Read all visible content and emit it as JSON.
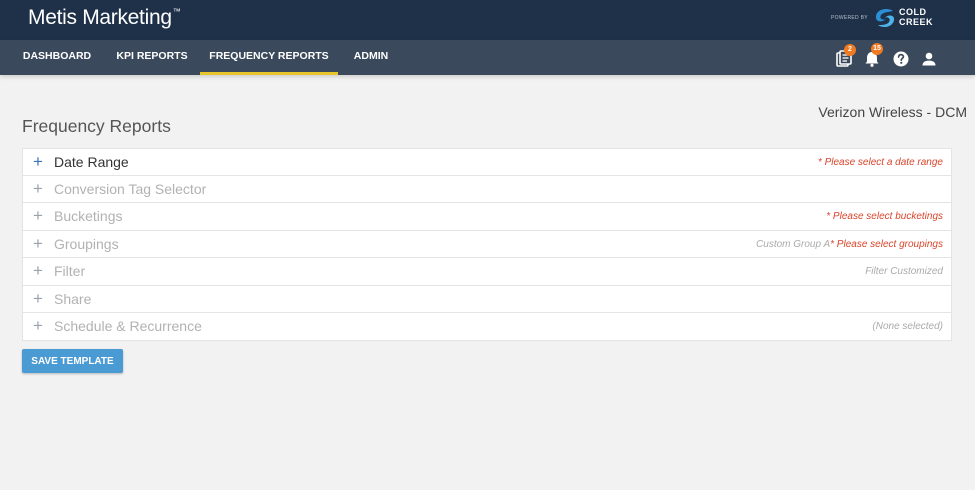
{
  "app": {
    "brand": "Metis Marketing",
    "brand_tm": "™",
    "powered_by": "POWERED BY",
    "partner_line1": "COLD",
    "partner_line2": "CREEK"
  },
  "nav": {
    "items": [
      {
        "label": "DASHBOARD"
      },
      {
        "label": "KPI REPORTS"
      },
      {
        "label": "FREQUENCY REPORTS",
        "active": true
      },
      {
        "label": "ADMIN"
      }
    ],
    "icons": [
      {
        "name": "reports-icon",
        "badge": "2"
      },
      {
        "name": "bell-icon",
        "badge": "15"
      },
      {
        "name": "help-icon"
      },
      {
        "name": "user-icon"
      }
    ]
  },
  "page": {
    "client": "Verizon Wireless - DCM",
    "title": "Frequency Reports"
  },
  "sections": [
    {
      "label": "Date Range",
      "active": true,
      "note_grey": "",
      "note_red": "* Please select a date range"
    },
    {
      "label": "Conversion Tag Selector",
      "note_grey": "",
      "note_red": ""
    },
    {
      "label": "Bucketings",
      "note_grey": "",
      "note_red": "* Please select bucketings"
    },
    {
      "label": "Groupings",
      "note_grey": "Custom Group A",
      "note_red": "* Please select groupings"
    },
    {
      "label": "Filter",
      "note_grey": "Filter Customized",
      "note_red": ""
    },
    {
      "label": "Share",
      "note_grey": "",
      "note_red": ""
    },
    {
      "label": "Schedule & Recurrence",
      "note_grey": "(None selected)",
      "note_red": ""
    }
  ],
  "actions": {
    "save_template": "SAVE TEMPLATE"
  },
  "colors": {
    "header_bg": "#1e3149",
    "nav_bg": "#3a4a5c",
    "active_underline": "#e8c52c",
    "badge": "#f07a22",
    "required_text": "#d9452b",
    "button": "#4a9ad4"
  }
}
